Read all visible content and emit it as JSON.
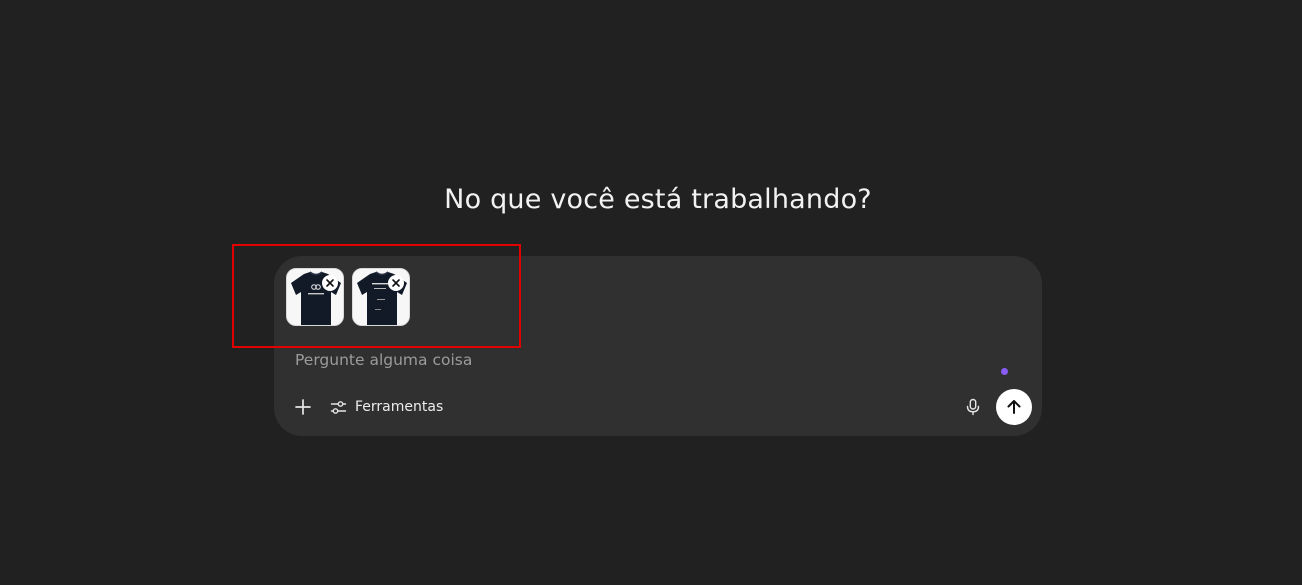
{
  "heading": "No que você está trabalhando?",
  "composer": {
    "placeholder": "Pergunte alguma coisa",
    "attachments": [
      {
        "icon": "tshirt-image",
        "remove_icon": "close-icon"
      },
      {
        "icon": "tshirt-image",
        "remove_icon": "close-icon"
      }
    ],
    "toolbar": {
      "add_icon": "plus-icon",
      "tools_icon": "sliders-icon",
      "tools_label": "Ferramentas",
      "mic_icon": "microphone-icon",
      "send_icon": "arrow-up-icon"
    }
  },
  "colors": {
    "background": "#212121",
    "composer": "#303030",
    "accent_dot": "#8a5cf6",
    "highlight": "#e00000"
  }
}
